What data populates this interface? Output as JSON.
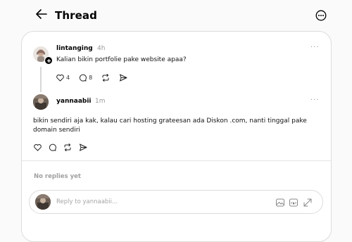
{
  "header": {
    "title": "Thread"
  },
  "post": {
    "username": "lintanging",
    "time": "4h",
    "text": "Kalian bikin portfolie pake website apaa?",
    "likes": "4",
    "comments": "8",
    "more": "···"
  },
  "reply": {
    "username": "yannaabii",
    "time": "1m",
    "text_line1": "bikin sendiri aja kak, kalau cari hosting grateesan ada Diskon .com, nanti tinggal pake",
    "text_line2": "domain sendiri",
    "more": "···"
  },
  "no_replies": "No replies yet",
  "composer": {
    "placeholder": "Reply to yannaabii..."
  },
  "colors": {
    "accent": "#000000",
    "muted": "#9a9a9a",
    "border": "#dcdcdc"
  },
  "icons": [
    "back-arrow-icon",
    "more-options-icon",
    "heart-icon",
    "comment-icon",
    "repost-icon",
    "share-icon",
    "image-icon",
    "gif-icon",
    "expand-icon"
  ]
}
